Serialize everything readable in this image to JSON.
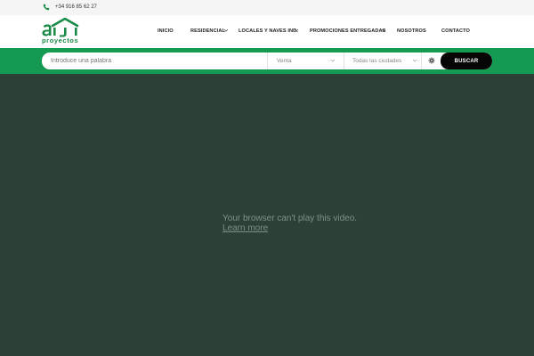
{
  "topbar": {
    "phone": "+34 916 85 62 27",
    "phone_icon": "phone-icon"
  },
  "header": {
    "logo_text": "proyectos",
    "logo_icon": "house-logo-icon",
    "brand_color": "#1a8b47",
    "nav": [
      {
        "label": "INICIO",
        "has_dropdown": false
      },
      {
        "label": "RESIDENCIAL",
        "has_dropdown": true
      },
      {
        "label": "LOCALES Y NAVES IND.",
        "has_dropdown": true
      },
      {
        "label": "PROMOCIONES ENTREGADAS",
        "has_dropdown": true
      },
      {
        "label": "NOSOTROS",
        "has_dropdown": false
      },
      {
        "label": "CONTACTO",
        "has_dropdown": false
      }
    ]
  },
  "search": {
    "band_color": "#159a52",
    "keyword_placeholder": "Introduce una palabra",
    "operation_value": "Venta",
    "city_value": "Todas las ciudades",
    "settings_icon": "gear-icon",
    "button_label": "BUSCAR"
  },
  "video": {
    "message": "Your browser can't play this video.",
    "link_text": "Learn more"
  }
}
